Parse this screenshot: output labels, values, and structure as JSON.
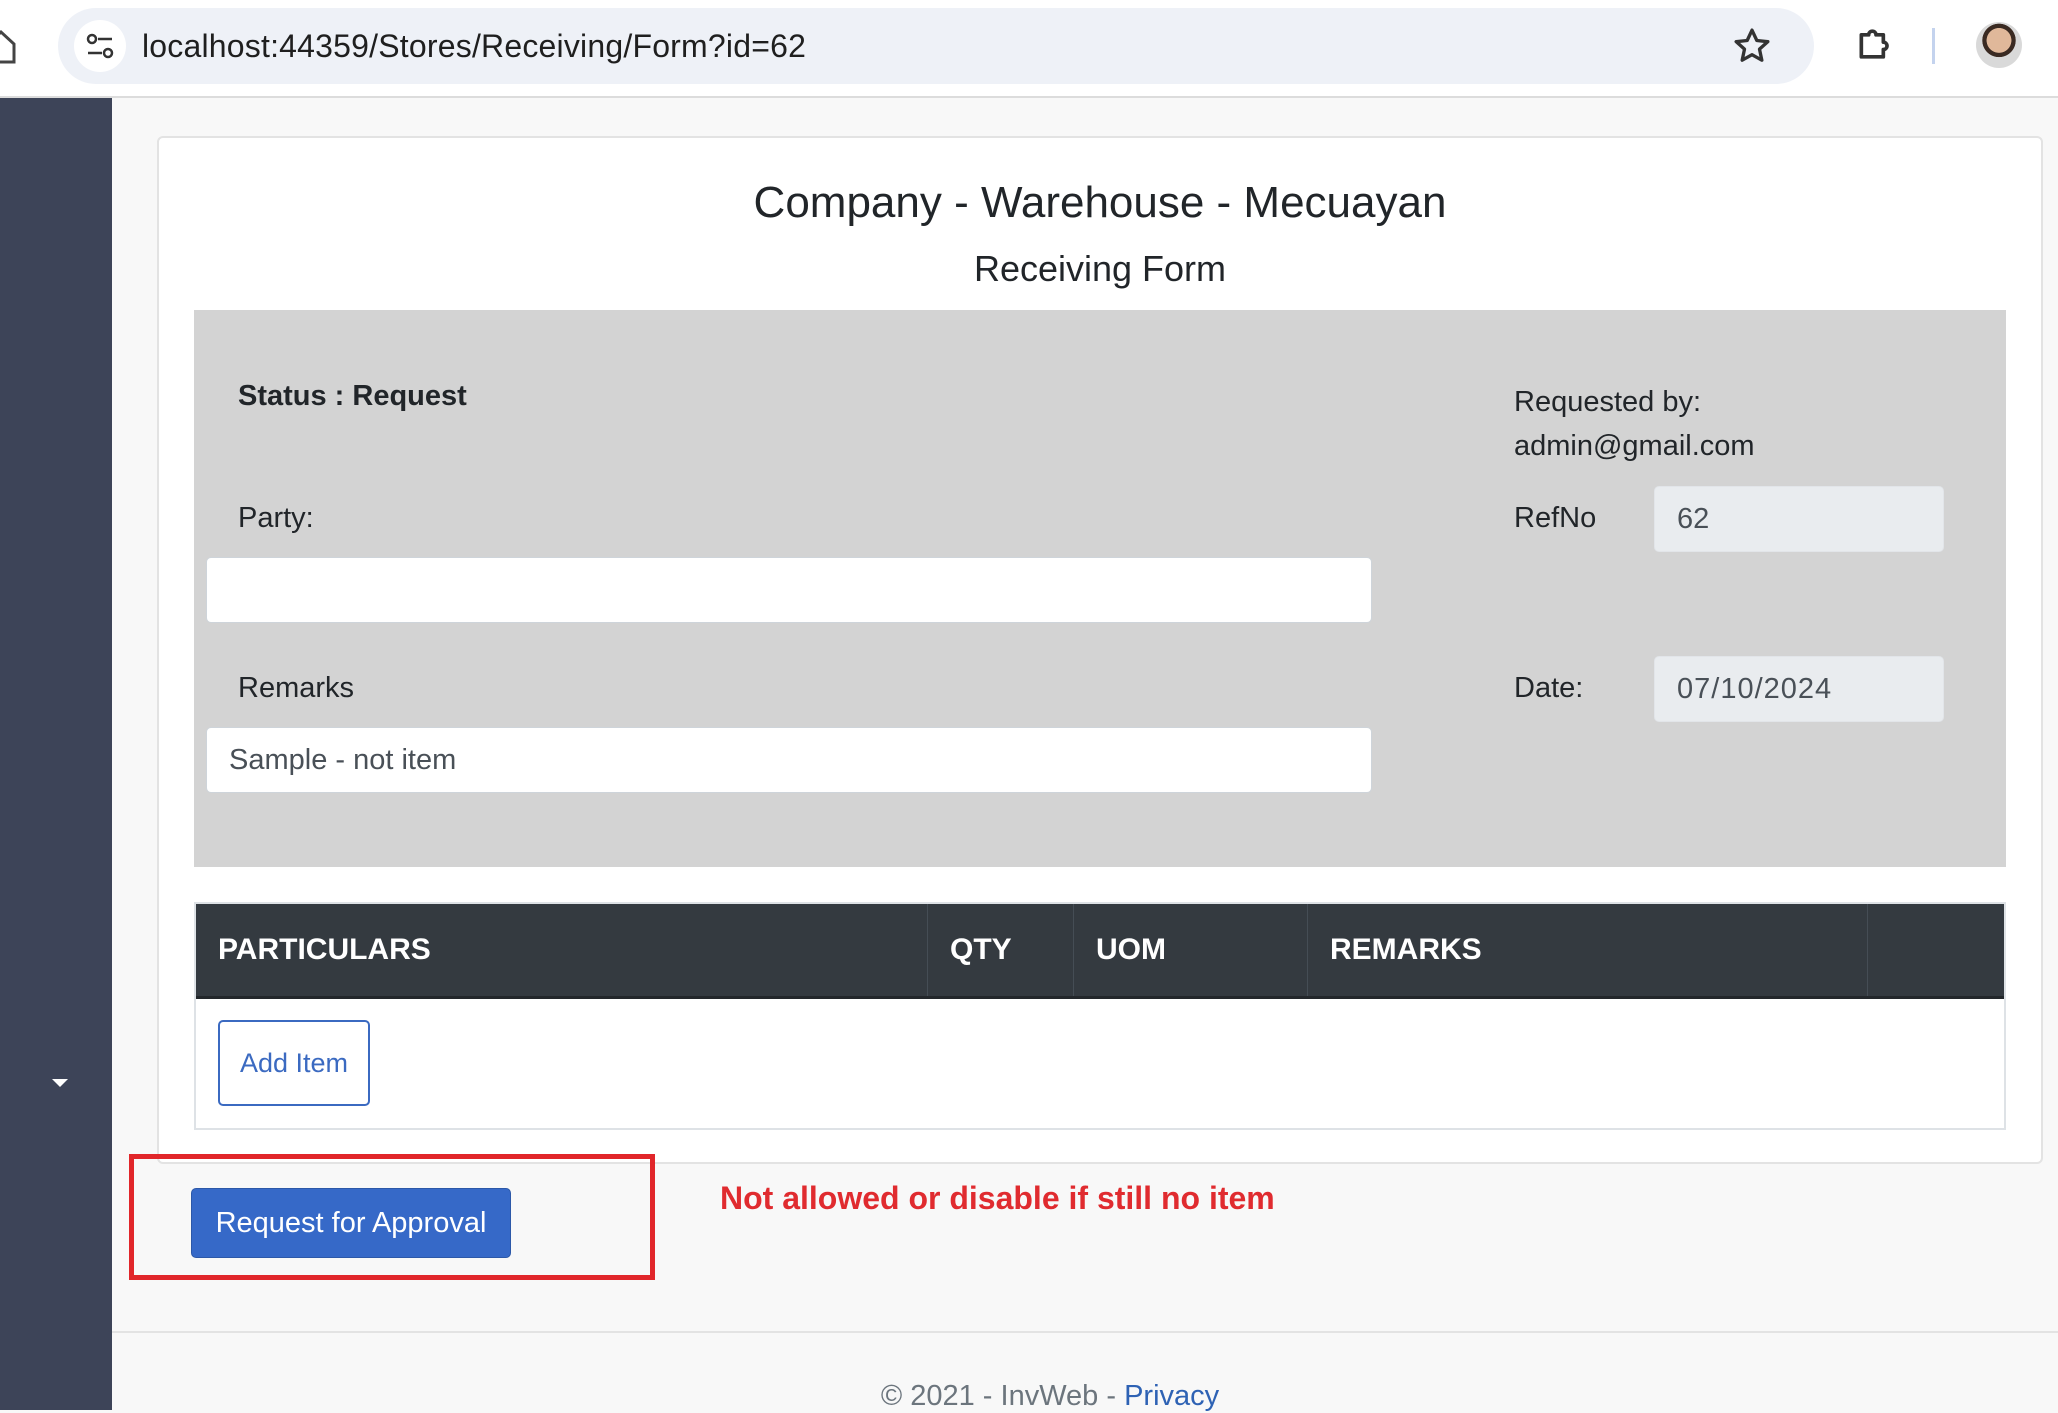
{
  "browser": {
    "url": "localhost:44359/Stores/Receiving/Form?id=62"
  },
  "form": {
    "company_title": "Company - Warehouse - Mecuayan",
    "form_title": "Receiving Form",
    "status_text": "Status : Request",
    "requested_by_label": "Requested by:",
    "requested_by_value": "admin@gmail.com",
    "party_label": "Party:",
    "party_value": "",
    "refno_label": "RefNo",
    "refno_value": "62",
    "remarks_label": "Remarks",
    "remarks_value": "Sample - not item",
    "date_label": "Date:",
    "date_value": "07/10/2024"
  },
  "table": {
    "columns": [
      "PARTICULARS",
      "QTY",
      "UOM",
      "REMARKS",
      ""
    ],
    "rows": [],
    "add_item_label": "Add Item"
  },
  "actions": {
    "approve_label": "Request for Approval"
  },
  "annotation": {
    "text": "Not allowed or disable if still no item",
    "color": "#e02b2f"
  },
  "footer": {
    "copyright": "© 2021 - InvWeb - ",
    "privacy_link": "Privacy"
  },
  "colors": {
    "sidebar": "#3d4458",
    "primary": "#3669c8",
    "table_header": "#343a40",
    "panel": "#d3d3d3"
  }
}
